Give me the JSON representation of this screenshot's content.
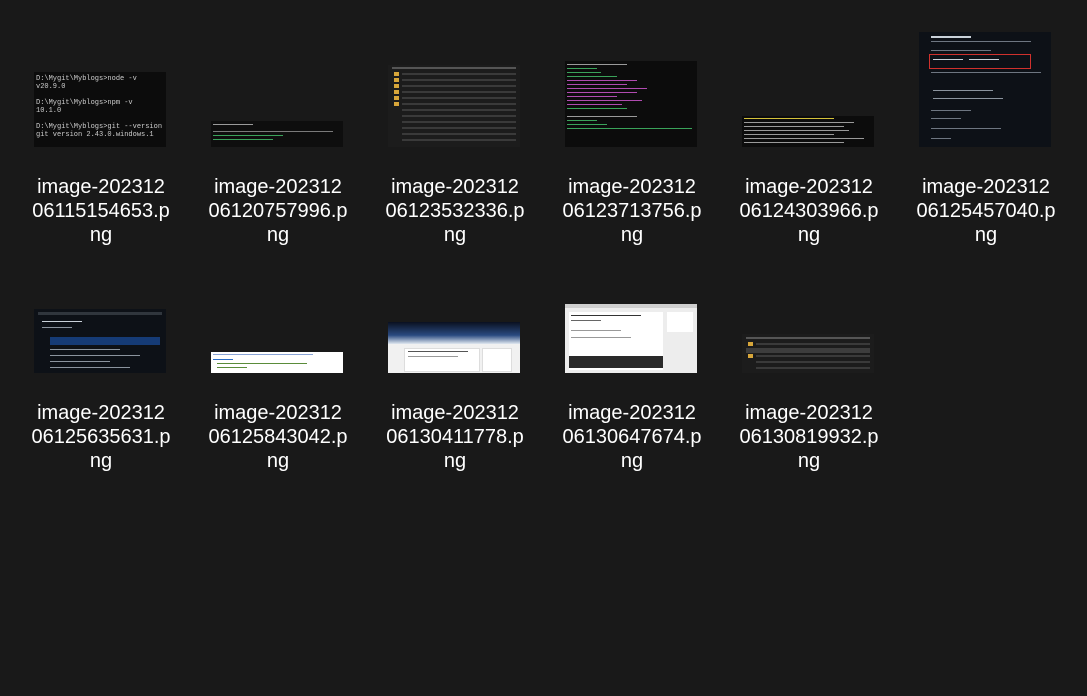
{
  "window": {
    "background": "#191919"
  },
  "files": [
    {
      "name_line1": "image-202312",
      "name_line2": "06115154653.p",
      "name_line3": "ng",
      "thumb": "terminal-node-version"
    },
    {
      "name_line1": "image-202312",
      "name_line2": "06120757996.p",
      "name_line3": "ng",
      "thumb": "terminal-hexo-new"
    },
    {
      "name_line1": "image-202312",
      "name_line2": "06123532336.p",
      "name_line3": "ng",
      "thumb": "file-explorer-list"
    },
    {
      "name_line1": "image-202312",
      "name_line2": "06123713756.p",
      "name_line3": "ng",
      "thumb": "terminal-hexo-server"
    },
    {
      "name_line1": "image-202312",
      "name_line2": "06124303966.p",
      "name_line3": "ng",
      "thumb": "terminal-ssh-keygen"
    },
    {
      "name_line1": "image-202312",
      "name_line2": "06125457040.p",
      "name_line3": "ng",
      "thumb": "github-create-repository"
    },
    {
      "name_line1": "image-202312",
      "name_line2": "06125635631.p",
      "name_line3": "ng",
      "thumb": "github-repository-page"
    },
    {
      "name_line1": "image-202312",
      "name_line2": "06125843042.p",
      "name_line3": "ng",
      "thumb": "config-file-deploy"
    },
    {
      "name_line1": "image-202312",
      "name_line2": "06130411778.p",
      "name_line3": "ng",
      "thumb": "blog-homepage"
    },
    {
      "name_line1": "image-202312",
      "name_line2": "06130647674.p",
      "name_line3": "ng",
      "thumb": "blog-article-page"
    },
    {
      "name_line1": "image-202312",
      "name_line2": "06130819932.p",
      "name_line3": "ng",
      "thumb": "file-explorer-small"
    }
  ],
  "thumb_text": {
    "t1": "D:\\Mygit\\Myblogs>node -v\nv20.9.0\n\nD:\\Mygit\\Myblogs>npm -v\n10.1.0\n\nD:\\Mygit\\Myblogs>git --version\ngit version 2.43.0.windows.1"
  }
}
